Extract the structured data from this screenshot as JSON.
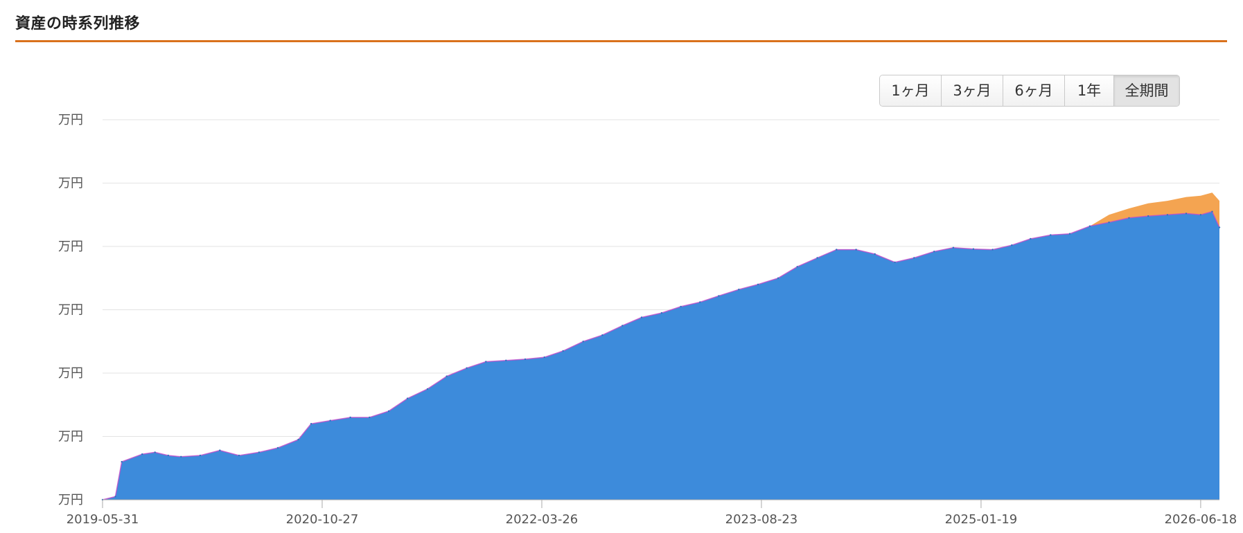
{
  "header": {
    "title": "資産の時系列推移"
  },
  "range_selector": {
    "buttons": [
      {
        "label": "1ヶ月",
        "active": false
      },
      {
        "label": "3ヶ月",
        "active": false
      },
      {
        "label": "6ヶ月",
        "active": false
      },
      {
        "label": "1年",
        "active": false
      },
      {
        "label": "全期間",
        "active": true
      }
    ]
  },
  "colors": {
    "accent": "#d9711c",
    "series_main": "#3d8bdb",
    "series_gain": "#f4a451",
    "series_loss": "#c24bc9"
  },
  "chart_data": {
    "type": "area",
    "title": "",
    "xlabel": "",
    "ylabel": "",
    "x_ticks": [
      "2019-05-31",
      "2020-10-27",
      "2022-03-26",
      "2023-08-23",
      "2025-01-19",
      "2026-06-18"
    ],
    "y_ticks": [
      "万円",
      "万円",
      "万円",
      "万円",
      "万円",
      "万円",
      "万円"
    ],
    "x_range": [
      "2019-05-31",
      "2026-08-01"
    ],
    "y_range": [
      0,
      6
    ],
    "y_unit_note": "tick labels show only the unit 万円; numeric values are not printed",
    "grid": true,
    "series": [
      {
        "role": "main",
        "color": "#3d8bdb",
        "points": [
          [
            "2019-05-31",
            0.0
          ],
          [
            "2019-06-30",
            0.05
          ],
          [
            "2019-07-15",
            0.6
          ],
          [
            "2019-09-01",
            0.72
          ],
          [
            "2019-10-01",
            0.75
          ],
          [
            "2019-11-01",
            0.7
          ],
          [
            "2019-12-01",
            0.68
          ],
          [
            "2020-01-15",
            0.7
          ],
          [
            "2020-03-01",
            0.78
          ],
          [
            "2020-04-15",
            0.7
          ],
          [
            "2020-06-01",
            0.75
          ],
          [
            "2020-07-15",
            0.82
          ],
          [
            "2020-09-01",
            0.95
          ],
          [
            "2020-10-01",
            1.2
          ],
          [
            "2020-11-15",
            1.25
          ],
          [
            "2021-01-01",
            1.3
          ],
          [
            "2021-02-15",
            1.3
          ],
          [
            "2021-04-01",
            1.4
          ],
          [
            "2021-05-15",
            1.6
          ],
          [
            "2021-07-01",
            1.75
          ],
          [
            "2021-08-15",
            1.95
          ],
          [
            "2021-10-01",
            2.08
          ],
          [
            "2021-11-15",
            2.18
          ],
          [
            "2022-01-01",
            2.2
          ],
          [
            "2022-02-15",
            2.22
          ],
          [
            "2022-04-01",
            2.25
          ],
          [
            "2022-05-15",
            2.35
          ],
          [
            "2022-07-01",
            2.5
          ],
          [
            "2022-08-15",
            2.6
          ],
          [
            "2022-10-01",
            2.75
          ],
          [
            "2022-11-15",
            2.88
          ],
          [
            "2023-01-01",
            2.95
          ],
          [
            "2023-02-15",
            3.05
          ],
          [
            "2023-04-01",
            3.12
          ],
          [
            "2023-05-15",
            3.22
          ],
          [
            "2023-07-01",
            3.32
          ],
          [
            "2023-08-15",
            3.4
          ],
          [
            "2023-10-01",
            3.5
          ],
          [
            "2023-11-15",
            3.68
          ],
          [
            "2024-01-01",
            3.82
          ],
          [
            "2024-02-15",
            3.95
          ],
          [
            "2024-04-01",
            3.95
          ],
          [
            "2024-05-15",
            3.88
          ],
          [
            "2024-07-01",
            3.75
          ],
          [
            "2024-08-15",
            3.82
          ],
          [
            "2024-10-01",
            3.92
          ],
          [
            "2024-11-15",
            3.98
          ],
          [
            "2025-01-01",
            3.96
          ],
          [
            "2025-02-15",
            3.95
          ],
          [
            "2025-04-01",
            4.02
          ],
          [
            "2025-05-15",
            4.12
          ],
          [
            "2025-07-01",
            4.18
          ],
          [
            "2025-08-15",
            4.2
          ],
          [
            "2025-10-01",
            4.32
          ],
          [
            "2025-11-15",
            4.38
          ],
          [
            "2026-01-01",
            4.45
          ],
          [
            "2026-02-15",
            4.48
          ],
          [
            "2026-04-01",
            4.5
          ],
          [
            "2026-05-15",
            4.52
          ],
          [
            "2026-06-18",
            4.5
          ],
          [
            "2026-07-15",
            4.55
          ],
          [
            "2026-08-01",
            4.3
          ]
        ]
      },
      {
        "role": "gain",
        "color": "#f4a451",
        "points": [
          [
            "2025-10-01",
            4.32
          ],
          [
            "2025-11-15",
            4.5
          ],
          [
            "2026-01-01",
            4.6
          ],
          [
            "2026-02-15",
            4.68
          ],
          [
            "2026-04-01",
            4.72
          ],
          [
            "2026-05-15",
            4.78
          ],
          [
            "2026-06-18",
            4.8
          ],
          [
            "2026-07-15",
            4.85
          ],
          [
            "2026-08-01",
            4.72
          ]
        ]
      }
    ]
  }
}
